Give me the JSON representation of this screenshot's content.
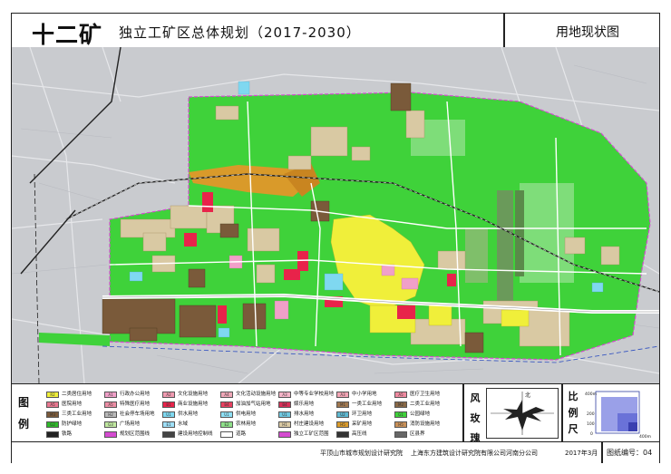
{
  "header": {
    "title_main": "十二矿",
    "title_sub": "独立工矿区总体规划（2017-2030）",
    "title_right": "用地现状图"
  },
  "colors": {
    "green_space": "#3fd23a",
    "farmland": "#8fe08a",
    "industrial": "#7a5a3a",
    "residential": "#f0ef3a",
    "village": "#d9c9a3",
    "mining": "#d99a2a",
    "commercial": "#e8234a",
    "public": "#e8a0b8",
    "water": "#7fd8f0",
    "boundary": "#d44bd0",
    "road": "#ffffff",
    "background": "#c9cbcf"
  },
  "legend": {
    "label": "图例",
    "items": [
      {
        "code": "R2",
        "label": "二类居住用地",
        "color": "#f0ef3a"
      },
      {
        "code": "A1",
        "label": "行政办公用地",
        "color": "#f0a0c8"
      },
      {
        "code": "A2",
        "label": "文化设施用地",
        "color": "#f09ab0"
      },
      {
        "code": "A4",
        "label": "文化活动设施用地",
        "color": "#f0a8b8"
      },
      {
        "code": "A3",
        "label": "中等专业学校用地",
        "color": "#f5b5c8"
      },
      {
        "code": "A3",
        "label": "中小学用地",
        "color": "#f3a5b5"
      },
      {
        "code": "A5",
        "label": "医疗卫生用地",
        "color": "#f08aa0"
      },
      {
        "code": "A5",
        "label": "医院用地",
        "color": "#e87890"
      },
      {
        "code": "A5",
        "label": "特殊医疗用地",
        "color": "#ec8ea5"
      },
      {
        "code": "B1",
        "label": "商业设施用地",
        "color": "#e8234a"
      },
      {
        "code": "B4",
        "label": "加油加气站用地",
        "color": "#e84060"
      },
      {
        "code": "B4",
        "label": "娱乐用地",
        "color": "#d83058"
      },
      {
        "code": "M1",
        "label": "一类工业用地",
        "color": "#a07850"
      },
      {
        "code": "M2",
        "label": "二类工业用地",
        "color": "#8a6a48"
      },
      {
        "code": "M3",
        "label": "三类工业用地",
        "color": "#7a5a3a"
      },
      {
        "code": "H2",
        "label": "社会停车场用地",
        "color": "#b8b8b8"
      },
      {
        "code": "U1",
        "label": "供水用地",
        "color": "#7fd8f0"
      },
      {
        "code": "U1",
        "label": "供电用地",
        "color": "#8ee0f5"
      },
      {
        "code": "U1",
        "label": "排水用地",
        "color": "#6fc8e0"
      },
      {
        "code": "U2",
        "label": "环卫用地",
        "color": "#5fb8d0"
      },
      {
        "code": "G1",
        "label": "公园绿地",
        "color": "#3fd23a"
      },
      {
        "code": "G2",
        "label": "防护绿地",
        "color": "#2fb82a"
      },
      {
        "code": "G3",
        "label": "广场用地",
        "color": "#c0e8a0"
      },
      {
        "code": "E1",
        "label": "水域",
        "color": "#9fe0f8"
      },
      {
        "code": "E2",
        "label": "农林用地",
        "color": "#8fe08a"
      },
      {
        "code": "H1",
        "label": "村庄建设用地",
        "color": "#d9c9a3"
      },
      {
        "code": "H5",
        "label": "采矿用地",
        "color": "#d99a2a"
      },
      {
        "code": "H5",
        "label": "消防设施用地",
        "color": "#c89058"
      },
      {
        "code": "",
        "label": "铁路",
        "color": "#222222"
      },
      {
        "code": "",
        "label": "规划区范围线",
        "color": "#d44bd0"
      },
      {
        "code": "",
        "label": "建设用地控制线",
        "color": "#444444"
      },
      {
        "code": "",
        "label": "道路",
        "color": "#ffffff"
      },
      {
        "code": "",
        "label": "独立工矿区范围",
        "color": "#d44bd0"
      },
      {
        "code": "",
        "label": "高压线",
        "color": "#333333"
      },
      {
        "code": "",
        "label": "区县界",
        "color": "#666666"
      }
    ]
  },
  "compass": {
    "label": "风玫瑰",
    "north": "北"
  },
  "scale": {
    "label": "比例尺",
    "ticks": [
      "400m",
      "200",
      "100",
      "0"
    ],
    "end": "400m"
  },
  "footer": {
    "org1": "平顶山市城市规划设计研究院",
    "org2": "上海东方建筑设计研究院有限公司河南分公司",
    "date": "2017年3月",
    "sheet": "图纸编号：04"
  }
}
